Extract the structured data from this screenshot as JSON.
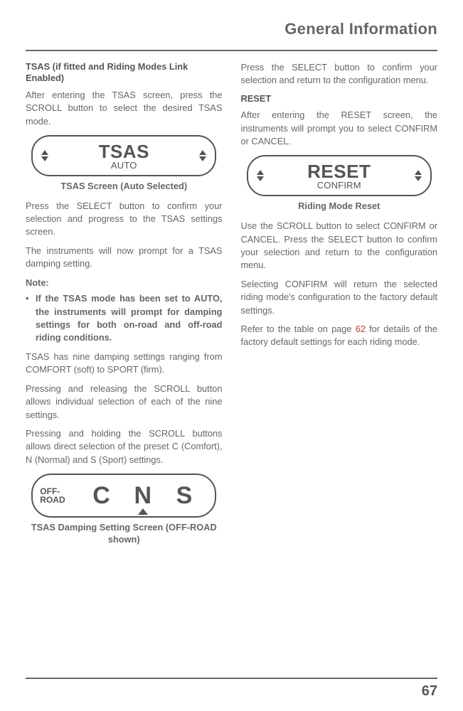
{
  "header": {
    "title": "General Information"
  },
  "left": {
    "h1": "TSAS (if fitted and Riding Modes Link Enabled)",
    "p1": "After entering the TSAS screen, press the SCROLL button to select the desired TSAS mode.",
    "lcd1": {
      "big": "TSAS",
      "small": "AUTO"
    },
    "cap1": "TSAS Screen (Auto Selected)",
    "p2": "Press the SELECT button to confirm your selection and progress to the TSAS settings screen.",
    "p3": "The instruments will now prompt for a TSAS damping setting.",
    "noteH": "Note:",
    "noteBullet": "•",
    "noteText": "If the TSAS mode has been set to AUTO, the instruments will prompt for damping settings for both on-road and off-road riding conditions.",
    "p4": "TSAS has nine damping settings ranging from COMFORT (soft) to SPORT (firm).",
    "p5": "Pressing and releasing the SCROLL button allows individual selection of each of the nine settings.",
    "p6": "Pressing and holding the SCROLL buttons allows direct selection of the preset C (Comfort), N (Normal) and S (Sport) settings.",
    "lcd2": {
      "label": "OFF-\nROAD",
      "c": "C",
      "n": "N",
      "s": "S"
    },
    "cap2": "TSAS Damping Setting Screen (OFF-ROAD shown)"
  },
  "right": {
    "p1": "Press the SELECT button to confirm your selection and return to the configuration menu.",
    "h1": "RESET",
    "p2": "After entering the RESET screen, the instruments will prompt you to select CONFIRM or CANCEL.",
    "lcd1": {
      "big": "RESET",
      "small": "CONFIRM"
    },
    "cap1": "Riding Mode Reset",
    "p3": "Use the SCROLL button to select CONFIRM or CANCEL. Press the SELECT button to confirm your selection and return to the configuration menu.",
    "p4": "Selecting CONFIRM will return the selected riding mode's configuration to the factory default settings.",
    "p5a": "Refer to the table on page ",
    "p5link": "62",
    "p5b": " for details of the factory default settings for each riding mode."
  },
  "footer": {
    "page": "67"
  }
}
